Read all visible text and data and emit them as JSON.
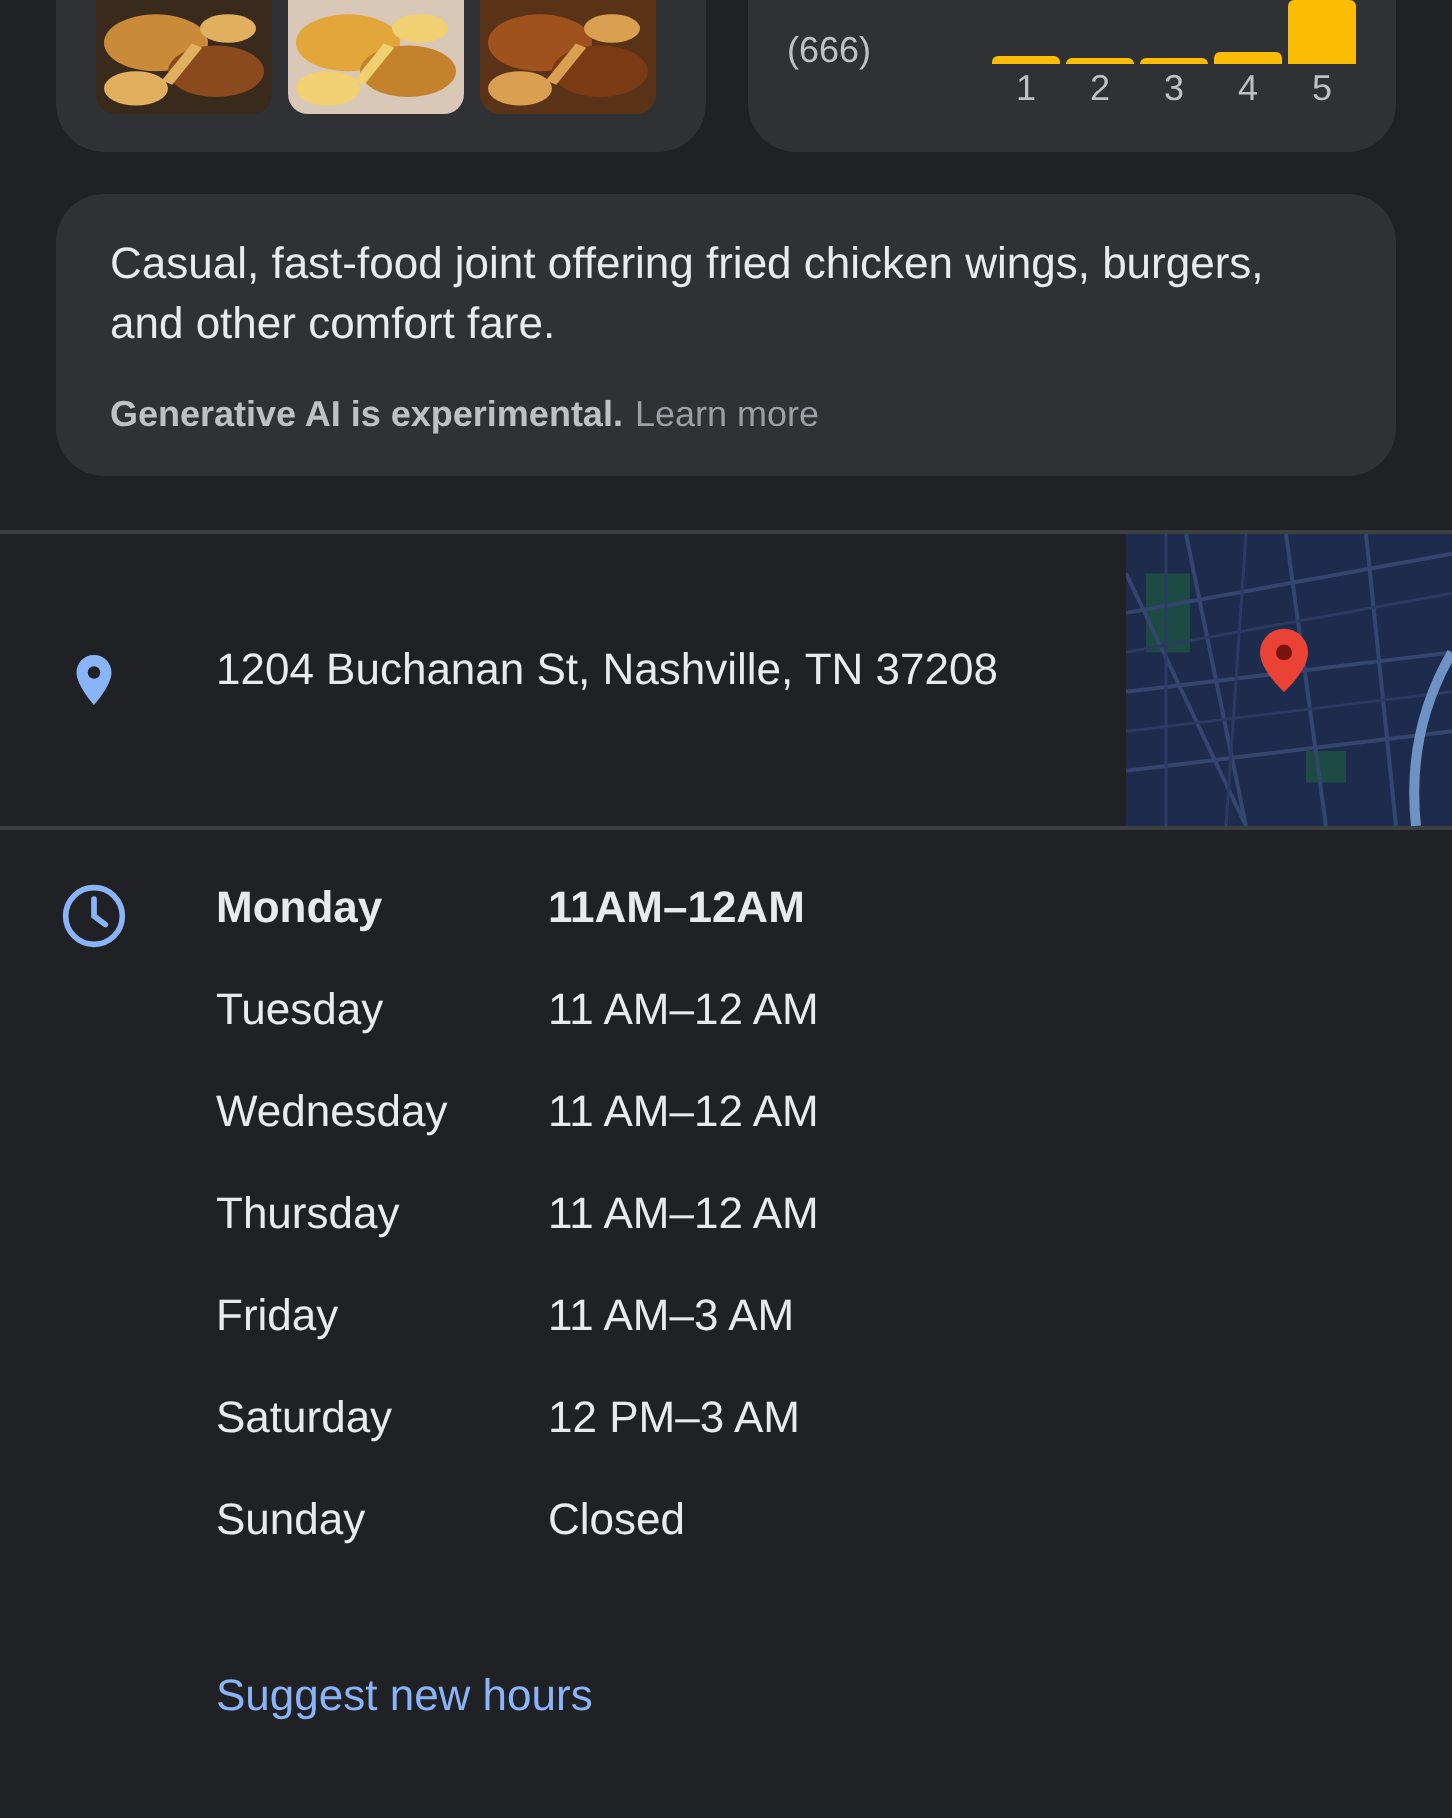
{
  "rating": {
    "count": "(666)",
    "bars": [
      {
        "label": "1"
      },
      {
        "label": "2"
      },
      {
        "label": "3"
      },
      {
        "label": "4"
      },
      {
        "label": "5"
      }
    ]
  },
  "summary": {
    "text": "Casual, fast-food joint offering fried chicken wings, burgers, and other comfort fare.",
    "disclaimer": "Generative AI is experimental.",
    "link": "Learn more"
  },
  "address": {
    "text": "1204 Buchanan St, Nashville, TN 37208"
  },
  "hours": [
    {
      "day": "Monday",
      "time": "11AM–12AM",
      "today": true
    },
    {
      "day": "Tuesday",
      "time": "11 AM–12 AM",
      "today": false
    },
    {
      "day": "Wednesday",
      "time": "11 AM–12 AM",
      "today": false
    },
    {
      "day": "Thursday",
      "time": "11 AM–12 AM",
      "today": false
    },
    {
      "day": "Friday",
      "time": "11 AM–3 AM",
      "today": false
    },
    {
      "day": "Saturday",
      "time": "12 PM–3 AM",
      "today": false
    },
    {
      "day": "Sunday",
      "time": "Closed",
      "today": false
    }
  ],
  "suggest_link": "Suggest new hours"
}
